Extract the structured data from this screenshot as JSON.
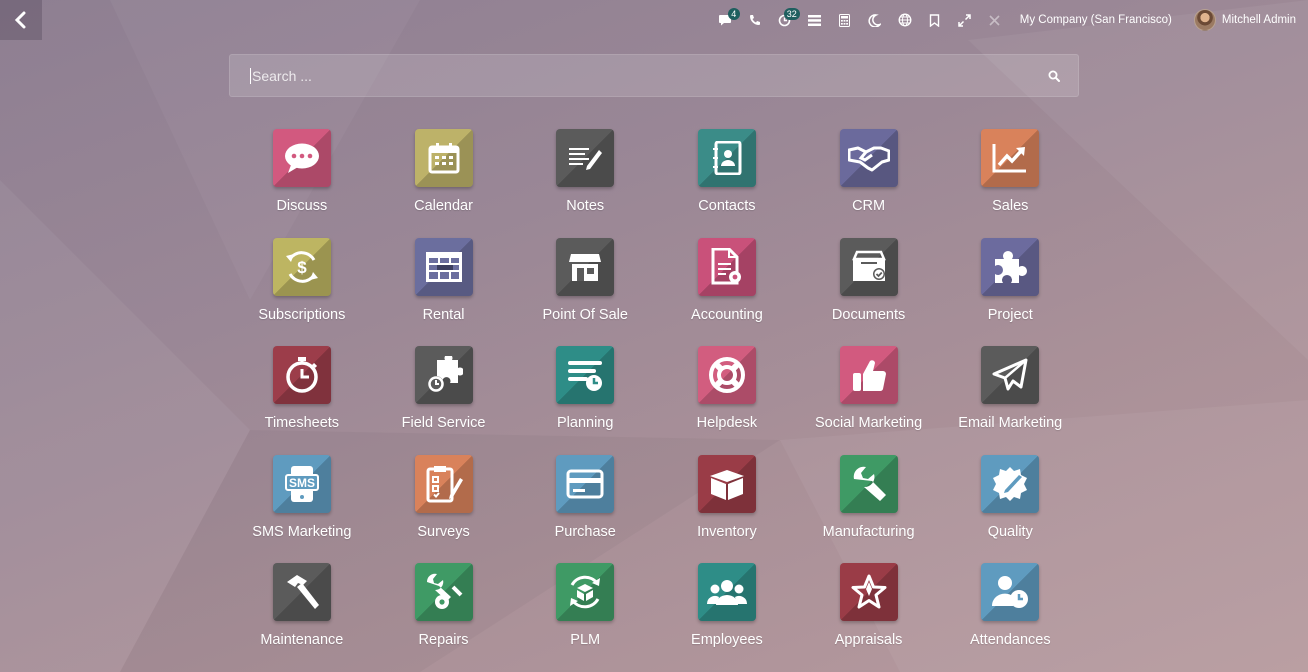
{
  "topbar": {
    "back_icon": "chevron-left-icon",
    "tray": [
      {
        "name": "chat-icon",
        "badge": "4"
      },
      {
        "name": "phone-icon",
        "badge": ""
      },
      {
        "name": "activity-clock-icon",
        "badge": "32"
      },
      {
        "name": "list-icon",
        "badge": ""
      },
      {
        "name": "calculator-icon",
        "badge": ""
      },
      {
        "name": "moon-icon",
        "badge": ""
      },
      {
        "name": "globe-icon",
        "badge": ""
      },
      {
        "name": "bookmark-icon",
        "badge": ""
      },
      {
        "name": "expand-icon",
        "badge": ""
      },
      {
        "name": "close-icon",
        "badge": ""
      }
    ],
    "company": "My Company (San Francisco)",
    "user": "Mitchell Admin"
  },
  "search": {
    "placeholder": "Search ...",
    "value": ""
  },
  "apps": [
    {
      "label": "Discuss",
      "color": "#d2597f",
      "icon": "chat-bubble-icon"
    },
    {
      "label": "Calendar",
      "color": "#bdb269",
      "icon": "calendar-icon"
    },
    {
      "label": "Notes",
      "color": "#5b5b5b",
      "icon": "notes-icon"
    },
    {
      "label": "Contacts",
      "color": "#3b8c88",
      "icon": "address-book-icon"
    },
    {
      "label": "CRM",
      "color": "#6b6a9c",
      "icon": "handshake-icon"
    },
    {
      "label": "Sales",
      "color": "#d9825b",
      "icon": "chart-line-icon"
    },
    {
      "label": "Subscriptions",
      "color": "#bdb562",
      "icon": "dollar-cycle-icon"
    },
    {
      "label": "Rental",
      "color": "#6b6e9e",
      "icon": "table-grid-icon"
    },
    {
      "label": "Point Of Sale",
      "color": "#5b5b5b",
      "icon": "store-icon"
    },
    {
      "label": "Accounting",
      "color": "#c9517a",
      "icon": "invoice-gear-icon"
    },
    {
      "label": "Documents",
      "color": "#5b5b5b",
      "icon": "inbox-check-icon"
    },
    {
      "label": "Project",
      "color": "#6c6b9e",
      "icon": "puzzle-icon"
    },
    {
      "label": "Timesheets",
      "color": "#9c3d4a",
      "icon": "stopwatch-icon"
    },
    {
      "label": "Field Service",
      "color": "#5b5b5b",
      "icon": "puzzle-timer-icon"
    },
    {
      "label": "Planning",
      "color": "#2e8d87",
      "icon": "planning-icon"
    },
    {
      "label": "Helpdesk",
      "color": "#d25d7f",
      "icon": "lifebuoy-icon"
    },
    {
      "label": "Social Marketing",
      "color": "#d25a7f",
      "icon": "thumbs-up-icon"
    },
    {
      "label": "Email Marketing",
      "color": "#5b5b5b",
      "icon": "paper-plane-icon"
    },
    {
      "label": "SMS Marketing",
      "color": "#5f9bbf",
      "icon": "sms-phone-icon"
    },
    {
      "label": "Surveys",
      "color": "#d9825b",
      "icon": "clipboard-pencil-icon"
    },
    {
      "label": "Purchase",
      "color": "#5f9bbf",
      "icon": "credit-card-icon"
    },
    {
      "label": "Inventory",
      "color": "#9a3c47",
      "icon": "box-icon"
    },
    {
      "label": "Manufacturing",
      "color": "#3f9a65",
      "icon": "wrench-icon"
    },
    {
      "label": "Quality",
      "color": "#5f9bbf",
      "icon": "gear-badge-icon"
    },
    {
      "label": "Maintenance",
      "color": "#5b5b5b",
      "icon": "hammer-icon"
    },
    {
      "label": "Repairs",
      "color": "#3f9a65",
      "icon": "wrench-gear-icon"
    },
    {
      "label": "PLM",
      "color": "#3f9a65",
      "icon": "cycle-box-icon"
    },
    {
      "label": "Employees",
      "color": "#2e8d87",
      "icon": "users-icon"
    },
    {
      "label": "Appraisals",
      "color": "#9a3c47",
      "icon": "star-icon"
    },
    {
      "label": "Attendances",
      "color": "#5f9bbf",
      "icon": "user-clock-icon"
    }
  ]
}
